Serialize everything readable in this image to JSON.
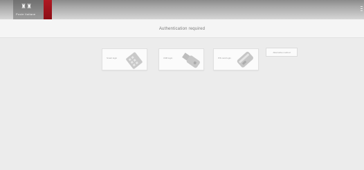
{
  "header": {
    "logo_alt": "Poste Italiane",
    "accent_color": "#a8141d",
    "menu_icon": "hamburger-menu-icon"
  },
  "auth": {
    "title": "Authentication required"
  },
  "options": [
    {
      "label": "Smart login",
      "icon": "smartcard-icon"
    },
    {
      "label": "USB login",
      "icon": "usb-key-icon"
    },
    {
      "label": "PIN card login",
      "icon": "pin-card-icon"
    }
  ],
  "alternative": {
    "label": "Alternative method"
  }
}
